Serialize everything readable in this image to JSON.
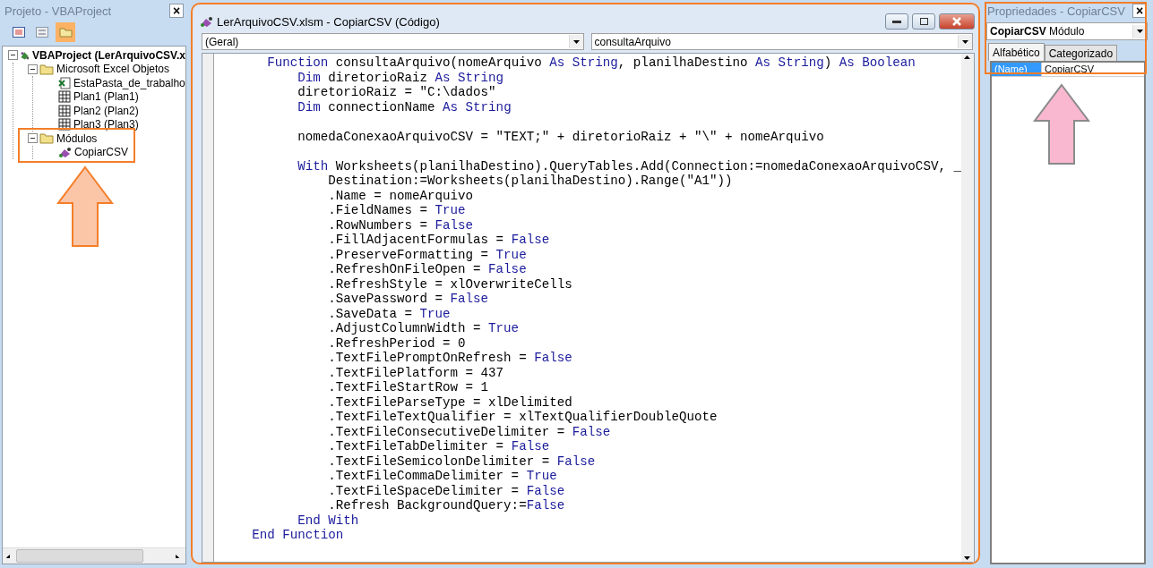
{
  "project_panel": {
    "title": "Projeto - VBAProject",
    "close": "×",
    "toolbar": [
      {
        "kind": "view-code",
        "selected": false
      },
      {
        "kind": "view-object",
        "selected": false
      },
      {
        "kind": "toggle-folders",
        "selected": true
      }
    ],
    "tree": [
      {
        "kind": "project",
        "label": "VBAProject (LerArquivoCSV.x",
        "expanded": true,
        "children": [
          {
            "kind": "folder",
            "label": "Microsoft Excel Objetos",
            "expanded": true,
            "children": [
              {
                "kind": "workbook",
                "label": "EstaPasta_de_trabalho"
              },
              {
                "kind": "sheet",
                "label": "Plan1 (Plan1)"
              },
              {
                "kind": "sheet",
                "label": "Plan2 (Plan2)"
              },
              {
                "kind": "sheet",
                "label": "Plan3 (Plan3)"
              }
            ]
          },
          {
            "kind": "folder",
            "label": "Módulos",
            "expanded": true,
            "children": [
              {
                "kind": "module",
                "label": "CopiarCSV"
              }
            ]
          }
        ]
      }
    ]
  },
  "code_window": {
    "title": "LerArquivoCSV.xlsm - CopiarCSV (Código)",
    "object_dropdown": "(Geral)",
    "procedure_dropdown": "consultaArquivo",
    "lines": [
      {
        "kind": "code",
        "segments": [
          {
            "kind": "keyword",
            "text": "       Function"
          },
          {
            "kind": "plain",
            "text": " consultaArquivo(nomeArquivo "
          },
          {
            "kind": "keyword",
            "text": "As String"
          },
          {
            "kind": "plain",
            "text": ", planilhaDestino "
          },
          {
            "kind": "keyword",
            "text": "As String"
          },
          {
            "kind": "plain",
            "text": ") "
          },
          {
            "kind": "keyword",
            "text": "As Boolean"
          }
        ]
      },
      {
        "kind": "code",
        "segments": [
          {
            "kind": "keyword",
            "text": "           Dim"
          },
          {
            "kind": "plain",
            "text": " diretorioRaiz "
          },
          {
            "kind": "keyword",
            "text": "As String"
          }
        ]
      },
      {
        "kind": "code",
        "segments": [
          {
            "kind": "plain",
            "text": "           diretorioRaiz = \"C:\\dados\""
          }
        ]
      },
      {
        "kind": "code",
        "segments": [
          {
            "kind": "keyword",
            "text": "           Dim"
          },
          {
            "kind": "plain",
            "text": " connectionName "
          },
          {
            "kind": "keyword",
            "text": "As String"
          }
        ]
      },
      {
        "kind": "blank"
      },
      {
        "kind": "code",
        "segments": [
          {
            "kind": "plain",
            "text": "           nomedaConexaoArquivoCSV = \"TEXT;\" + diretorioRaiz + \"\\\" + nomeArquivo"
          }
        ]
      },
      {
        "kind": "blank"
      },
      {
        "kind": "code",
        "segments": [
          {
            "kind": "keyword",
            "text": "           With"
          },
          {
            "kind": "plain",
            "text": " Worksheets(planilhaDestino).QueryTables.Add(Connection:=nomedaConexaoArquivoCSV, _"
          }
        ]
      },
      {
        "kind": "code",
        "segments": [
          {
            "kind": "plain",
            "text": "               Destination:=Worksheets(planilhaDestino).Range(\"A1\"))"
          }
        ]
      },
      {
        "kind": "code",
        "segments": [
          {
            "kind": "plain",
            "text": "               .Name = nomeArquivo"
          }
        ]
      },
      {
        "kind": "code",
        "segments": [
          {
            "kind": "plain",
            "text": "               .FieldNames = "
          },
          {
            "kind": "keyword",
            "text": "True"
          }
        ]
      },
      {
        "kind": "code",
        "segments": [
          {
            "kind": "plain",
            "text": "               .RowNumbers = "
          },
          {
            "kind": "keyword",
            "text": "False"
          }
        ]
      },
      {
        "kind": "code",
        "segments": [
          {
            "kind": "plain",
            "text": "               .FillAdjacentFormulas = "
          },
          {
            "kind": "keyword",
            "text": "False"
          }
        ]
      },
      {
        "kind": "code",
        "segments": [
          {
            "kind": "plain",
            "text": "               .PreserveFormatting = "
          },
          {
            "kind": "keyword",
            "text": "True"
          }
        ]
      },
      {
        "kind": "code",
        "segments": [
          {
            "kind": "plain",
            "text": "               .RefreshOnFileOpen = "
          },
          {
            "kind": "keyword",
            "text": "False"
          }
        ]
      },
      {
        "kind": "code",
        "segments": [
          {
            "kind": "plain",
            "text": "               .RefreshStyle = xlOverwriteCells"
          }
        ]
      },
      {
        "kind": "code",
        "segments": [
          {
            "kind": "plain",
            "text": "               .SavePassword = "
          },
          {
            "kind": "keyword",
            "text": "False"
          }
        ]
      },
      {
        "kind": "code",
        "segments": [
          {
            "kind": "plain",
            "text": "               .SaveData = "
          },
          {
            "kind": "keyword",
            "text": "True"
          }
        ]
      },
      {
        "kind": "code",
        "segments": [
          {
            "kind": "plain",
            "text": "               .AdjustColumnWidth = "
          },
          {
            "kind": "keyword",
            "text": "True"
          }
        ]
      },
      {
        "kind": "code",
        "segments": [
          {
            "kind": "plain",
            "text": "               .RefreshPeriod = 0"
          }
        ]
      },
      {
        "kind": "code",
        "segments": [
          {
            "kind": "plain",
            "text": "               .TextFilePromptOnRefresh = "
          },
          {
            "kind": "keyword",
            "text": "False"
          }
        ]
      },
      {
        "kind": "code",
        "segments": [
          {
            "kind": "plain",
            "text": "               .TextFilePlatform = 437"
          }
        ]
      },
      {
        "kind": "code",
        "segments": [
          {
            "kind": "plain",
            "text": "               .TextFileStartRow = 1"
          }
        ]
      },
      {
        "kind": "code",
        "segments": [
          {
            "kind": "plain",
            "text": "               .TextFileParseType = xlDelimited"
          }
        ]
      },
      {
        "kind": "code",
        "segments": [
          {
            "kind": "plain",
            "text": "               .TextFileTextQualifier = xlTextQualifierDoubleQuote"
          }
        ]
      },
      {
        "kind": "code",
        "segments": [
          {
            "kind": "plain",
            "text": "               .TextFileConsecutiveDelimiter = "
          },
          {
            "kind": "keyword",
            "text": "False"
          }
        ]
      },
      {
        "kind": "code",
        "segments": [
          {
            "kind": "plain",
            "text": "               .TextFileTabDelimiter = "
          },
          {
            "kind": "keyword",
            "text": "False"
          }
        ]
      },
      {
        "kind": "code",
        "segments": [
          {
            "kind": "plain",
            "text": "               .TextFileSemicolonDelimiter = "
          },
          {
            "kind": "keyword",
            "text": "False"
          }
        ]
      },
      {
        "kind": "code",
        "segments": [
          {
            "kind": "plain",
            "text": "               .TextFileCommaDelimiter = "
          },
          {
            "kind": "keyword",
            "text": "True"
          }
        ]
      },
      {
        "kind": "code",
        "segments": [
          {
            "kind": "plain",
            "text": "               .TextFileSpaceDelimiter = "
          },
          {
            "kind": "keyword",
            "text": "False"
          }
        ]
      },
      {
        "kind": "code",
        "segments": [
          {
            "kind": "plain",
            "text": "               .Refresh BackgroundQuery:="
          },
          {
            "kind": "keyword",
            "text": "False"
          }
        ]
      },
      {
        "kind": "code",
        "segments": [
          {
            "kind": "keyword",
            "text": "           End With"
          }
        ]
      },
      {
        "kind": "code",
        "segments": [
          {
            "kind": "keyword",
            "text": "     End Function"
          }
        ]
      }
    ]
  },
  "properties_panel": {
    "title": "Propriedades - CopiarCSV",
    "close": "×",
    "object_name": "CopiarCSV",
    "object_type": "Módulo",
    "tabs": [
      {
        "label": "Alfabético",
        "selected": true
      },
      {
        "label": "Categorizado",
        "selected": false
      }
    ],
    "rows": [
      {
        "name": "(Name)",
        "value": "CopiarCSV",
        "selected": true
      }
    ]
  }
}
